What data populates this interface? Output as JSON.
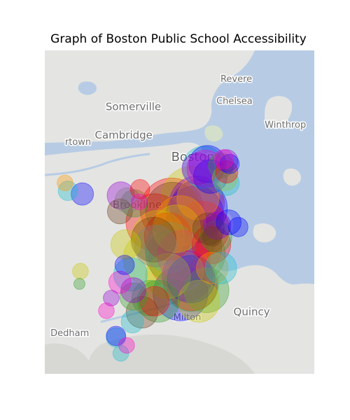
{
  "chart_data": {
    "type": "scatter",
    "title": "Graph of Boston Public School Accessibility",
    "basemap": {
      "place_labels": [
        {
          "key": "revere",
          "text": "Revere",
          "size": "small",
          "lon": -71.036,
          "lat": 42.41
        },
        {
          "key": "somerville",
          "text": "Somerville",
          "size": "medium",
          "lon": -71.143,
          "lat": 42.392
        },
        {
          "key": "chelsea",
          "text": "Chelsea",
          "size": "small",
          "lon": -71.038,
          "lat": 42.396
        },
        {
          "key": "winthrop",
          "text": "Winthrop",
          "size": "small",
          "lon": -70.985,
          "lat": 42.381
        },
        {
          "key": "cambridge",
          "text": "Cambridge",
          "size": "medium",
          "lon": -71.153,
          "lat": 42.374
        },
        {
          "key": "watertown",
          "text": "rtown",
          "size": "small",
          "lon": -71.214,
          "lat": 42.37
        },
        {
          "key": "boston",
          "text": "Boston",
          "size": "large",
          "lon": -71.081,
          "lat": 42.36
        },
        {
          "key": "brookline",
          "text": "Brookline",
          "size": "medium",
          "lon": -71.139,
          "lat": 42.33
        },
        {
          "key": "dedham",
          "text": "Dedham",
          "size": "small",
          "lon": -71.209,
          "lat": 42.249
        },
        {
          "key": "milton",
          "text": "Milton",
          "size": "small",
          "lon": -71.087,
          "lat": 42.259
        },
        {
          "key": "quincy",
          "text": "Quincy",
          "size": "medium",
          "lon": -71.02,
          "lat": 42.262
        }
      ],
      "colors": {
        "land": "#e4e4e2",
        "water": "#b7cce4",
        "park": "#d3dfcb",
        "label": "#6e6e6e"
      }
    },
    "extent": {
      "lon": [
        -71.235,
        -70.955
      ],
      "lat": [
        42.225,
        42.43
      ]
    },
    "marker_alpha": 0.35,
    "series": [
      {
        "color": "#ff0000",
        "points": [
          {
            "lon": -71.136,
            "lat": 42.342,
            "size": 3
          },
          {
            "lon": -71.121,
            "lat": 42.321,
            "size": 26
          },
          {
            "lon": -71.103,
            "lat": 42.329,
            "size": 32
          },
          {
            "lon": -71.082,
            "lat": 42.305,
            "size": 28
          },
          {
            "lon": -71.072,
            "lat": 42.317,
            "size": 24
          },
          {
            "lon": -71.095,
            "lat": 42.298,
            "size": 30
          },
          {
            "lon": -71.062,
            "lat": 42.307,
            "size": 12
          },
          {
            "lon": -71.082,
            "lat": 42.281,
            "size": 20
          },
          {
            "lon": -71.121,
            "lat": 42.271,
            "size": 7
          },
          {
            "lon": -71.046,
            "lat": 42.353,
            "size": 4
          },
          {
            "lon": -71.107,
            "lat": 42.312,
            "size": 18
          }
        ]
      },
      {
        "color": "#ff9900",
        "points": [
          {
            "lon": -71.214,
            "lat": 42.346,
            "size": 2
          },
          {
            "lon": -71.094,
            "lat": 42.322,
            "size": 20
          },
          {
            "lon": -71.061,
            "lat": 42.292,
            "size": 8
          },
          {
            "lon": -71.076,
            "lat": 42.336,
            "size": 14
          }
        ]
      },
      {
        "color": "#c8c800",
        "points": [
          {
            "lon": -71.082,
            "lat": 42.337,
            "size": 30
          },
          {
            "lon": -71.125,
            "lat": 42.298,
            "size": 24
          },
          {
            "lon": -71.107,
            "lat": 42.287,
            "size": 16
          },
          {
            "lon": -71.151,
            "lat": 42.307,
            "size": 7
          },
          {
            "lon": -71.117,
            "lat": 42.312,
            "size": 22
          },
          {
            "lon": -71.048,
            "lat": 42.349,
            "size": 5
          },
          {
            "lon": -71.098,
            "lat": 42.317,
            "size": 18
          },
          {
            "lon": -71.075,
            "lat": 42.271,
            "size": 14
          },
          {
            "lon": -71.198,
            "lat": 42.29,
            "size": 2
          }
        ]
      },
      {
        "color": "#33a02c",
        "points": [
          {
            "lon": -71.142,
            "lat": 42.333,
            "size": 6
          },
          {
            "lon": -71.076,
            "lat": 42.301,
            "size": 24
          },
          {
            "lon": -71.083,
            "lat": 42.282,
            "size": 24
          },
          {
            "lon": -71.117,
            "lat": 42.271,
            "size": 14
          },
          {
            "lon": -71.126,
            "lat": 42.273,
            "size": 10
          },
          {
            "lon": -71.057,
            "lat": 42.312,
            "size": 8
          },
          {
            "lon": -71.052,
            "lat": 42.357,
            "size": 5
          },
          {
            "lon": -71.067,
            "lat": 42.278,
            "size": 16
          },
          {
            "lon": -71.199,
            "lat": 42.282,
            "size": 1
          },
          {
            "lon": -71.143,
            "lat": 42.274,
            "size": 6
          },
          {
            "lon": -71.104,
            "lat": 42.3,
            "size": 20
          }
        ]
      },
      {
        "color": "#6a3d1a",
        "points": [
          {
            "lon": -71.102,
            "lat": 42.329,
            "size": 24
          },
          {
            "lon": -71.122,
            "lat": 42.31,
            "size": 16
          },
          {
            "lon": -71.065,
            "lat": 42.317,
            "size": 8
          },
          {
            "lon": -71.157,
            "lat": 42.328,
            "size": 5
          },
          {
            "lon": -71.134,
            "lat": 42.264,
            "size": 8
          },
          {
            "lon": -71.061,
            "lat": 42.312,
            "size": 3
          },
          {
            "lon": -71.086,
            "lat": 42.312,
            "size": 26
          }
        ]
      },
      {
        "color": "#17becf",
        "points": [
          {
            "lon": -71.07,
            "lat": 42.356,
            "size": 14
          },
          {
            "lon": -71.211,
            "lat": 42.341,
            "size": 3
          },
          {
            "lon": -71.146,
            "lat": 42.288,
            "size": 9
          },
          {
            "lon": -71.052,
            "lat": 42.292,
            "size": 8
          },
          {
            "lon": -71.144,
            "lat": 42.258,
            "size": 4
          },
          {
            "lon": -71.161,
            "lat": 42.248,
            "size": 3
          },
          {
            "lon": -71.156,
            "lat": 42.238,
            "size": 2
          },
          {
            "lon": -71.105,
            "lat": 42.305,
            "size": 20
          },
          {
            "lon": -71.046,
            "lat": 42.346,
            "size": 5
          }
        ]
      },
      {
        "color": "#0000ff",
        "points": [
          {
            "lon": -71.075,
            "lat": 42.33,
            "size": 26
          },
          {
            "lon": -71.079,
            "lat": 42.326,
            "size": 26
          },
          {
            "lon": -71.066,
            "lat": 42.358,
            "size": 11
          },
          {
            "lon": -71.063,
            "lat": 42.35,
            "size": 9
          },
          {
            "lon": -71.196,
            "lat": 42.339,
            "size": 4
          },
          {
            "lon": -71.094,
            "lat": 42.276,
            "size": 24
          },
          {
            "lon": -71.083,
            "lat": 42.285,
            "size": 18
          },
          {
            "lon": -71.152,
            "lat": 42.294,
            "size": 3
          },
          {
            "lon": -71.044,
            "lat": 42.321,
            "size": 5
          },
          {
            "lon": -71.034,
            "lat": 42.318,
            "size": 3
          },
          {
            "lon": -71.043,
            "lat": 42.358,
            "size": 3
          },
          {
            "lon": -71.161,
            "lat": 42.249,
            "size": 3
          }
        ]
      },
      {
        "color": "#9400d3",
        "points": [
          {
            "lon": -71.077,
            "lat": 42.333,
            "size": 24
          },
          {
            "lon": -71.087,
            "lat": 42.287,
            "size": 20
          },
          {
            "lon": -71.056,
            "lat": 42.319,
            "size": 6
          },
          {
            "lon": -71.156,
            "lat": 42.338,
            "size": 6
          },
          {
            "lon": -71.143,
            "lat": 42.278,
            "size": 5
          },
          {
            "lon": -71.046,
            "lat": 42.36,
            "size": 4
          },
          {
            "lon": -71.166,
            "lat": 42.273,
            "size": 2
          },
          {
            "lon": -71.076,
            "lat": 42.355,
            "size": 8
          }
        ]
      },
      {
        "color": "#ff00cc",
        "points": [
          {
            "lon": -71.068,
            "lat": 42.355,
            "size": 11
          },
          {
            "lon": -71.157,
            "lat": 42.283,
            "size": 4
          },
          {
            "lon": -71.049,
            "lat": 42.361,
            "size": 3
          },
          {
            "lon": -71.137,
            "lat": 42.334,
            "size": 2
          },
          {
            "lon": -71.092,
            "lat": 42.3,
            "size": 20
          },
          {
            "lon": -71.15,
            "lat": 42.243,
            "size": 2
          },
          {
            "lon": -71.171,
            "lat": 42.265,
            "size": 2
          }
        ]
      },
      {
        "color": "#7f7f7f",
        "points": [
          {
            "lon": -71.149,
            "lat": 42.335,
            "size": 5
          },
          {
            "lon": -71.12,
            "lat": 42.306,
            "size": 14
          },
          {
            "lon": -71.09,
            "lat": 42.29,
            "size": 12
          }
        ]
      }
    ]
  }
}
